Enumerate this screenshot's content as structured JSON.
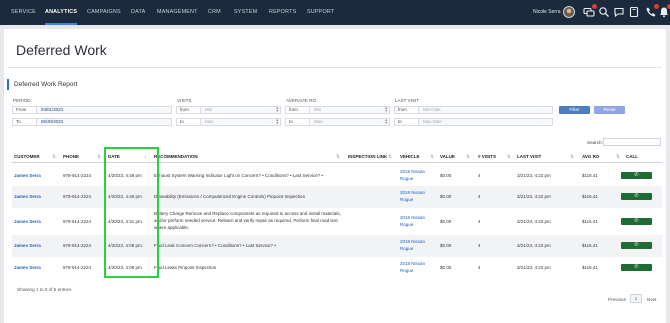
{
  "nav": {
    "items": [
      "SERVICE",
      "ANALYTICS",
      "CAMPAIGNS",
      "DATA",
      "MANAGEMENT",
      "CRM",
      "SYSTEM",
      "REPORTS",
      "SUPPORT"
    ],
    "active": "ANALYTICS",
    "user_name": "Nicole Serra"
  },
  "page": {
    "title": "Deferred Work",
    "section_title": "Deferred Work Report"
  },
  "filters": {
    "period_label": "PERIOD",
    "from_prefix": "From",
    "from_value": "04/01/2023",
    "to_prefix": "To",
    "to_value": "06/30/2023",
    "visits_label": "VISITS",
    "visits_from_prefix": "from",
    "visits_min_placeholder": "Min",
    "visits_to_prefix": "to",
    "visits_max_placeholder": "Max",
    "avgro_label": "AVERAGE RO",
    "avgro_from_prefix": "from",
    "avgro_min_placeholder": "Min",
    "avgro_to_prefix": "to",
    "avgro_max_placeholder": "Max",
    "lastvisit_label": "LAST VISIT",
    "lastvisit_from_prefix": "from",
    "lastvisit_min_placeholder": "Min Date",
    "lastvisit_to_prefix": "to",
    "lastvisit_max_placeholder": "Max Date",
    "filter_button": "Filter",
    "reset_button": "Reset"
  },
  "search": {
    "label": "Search:",
    "value": ""
  },
  "table": {
    "columns": [
      "CUSTOMER",
      "PHONE",
      "DATE",
      "RECOMMENDATION",
      "INSPECTION LINK",
      "VEHICLE",
      "VALUE",
      "# VISITS",
      "LAST VISIT",
      "AVG RO",
      "CALL"
    ],
    "rows": [
      {
        "customer": "James Serra",
        "phone": "978-914-2224",
        "date": "4/20/23, 4:46 pm",
        "recommendation": "Exhaust System Warning Indicator Light on Concern? • Conditions? • Last Service? •",
        "vehicle_line1": "2018 Nissan",
        "vehicle_line2": "Rogue",
        "value": "$0.00",
        "visits": "4",
        "last_visit": "3/21/23, 4:22 pm",
        "avg_ro": "$116.41",
        "call_icon": "phone-icon"
      },
      {
        "customer": "James Serra",
        "phone": "978-914-2224",
        "date": "4/20/23, 4:46 pm",
        "recommendation": "Driveability (Emissions / Computerized Engine Controls) Pinpoint Inspection",
        "vehicle_line1": "2018 Nissan",
        "vehicle_line2": "Rogue",
        "value": "$0.00",
        "visits": "4",
        "last_visit": "3/21/23, 4:22 pm",
        "avg_ro": "$116.41",
        "call_icon": "phone-icon"
      },
      {
        "customer": "James Serra",
        "phone": "978-914-2224",
        "date": "4/20/23, 4:31 pm",
        "recommendation": "Battery Charge Remove and Replace components as required to access and install materials, and/or perform needed service. Relearn and verify repair as required. Perform final road test where applicable.",
        "vehicle_line1": "2018 Nissan",
        "vehicle_line2": "Rogue",
        "value": "$0.00",
        "visits": "4",
        "last_visit": "3/21/23, 4:22 pm",
        "avg_ro": "$116.41",
        "call_icon": "phone-icon"
      },
      {
        "customer": "James Serra",
        "phone": "978-914-2224",
        "date": "4/20/23, 4:08 pm",
        "recommendation": "Fluid Leak Concern Concern? • Conditions? • Last Service? •",
        "vehicle_line1": "2018 Nissan",
        "vehicle_line2": "Rogue",
        "value": "$0.00",
        "visits": "4",
        "last_visit": "3/21/23, 4:22 pm",
        "avg_ro": "$116.41",
        "call_icon": "phone-icon"
      },
      {
        "customer": "James Serra",
        "phone": "978-914-2224",
        "date": "4/20/23, 4:08 pm",
        "recommendation": "Fluid Leaks Pinpoint Inspection",
        "vehicle_line1": "2018 Nissan",
        "vehicle_line2": "Rogue",
        "value": "$0.00",
        "visits": "4",
        "last_visit": "3/21/23, 4:22 pm",
        "avg_ro": "$116.41",
        "call_icon": "phone-icon"
      }
    ]
  },
  "footer": {
    "showing": "Showing 1 to 5 of 5 entries",
    "previous": "Previous",
    "page": "1",
    "next": "Next"
  },
  "colors": {
    "nav_bg": "#1c2a3d",
    "accent": "#2f6fd6",
    "call_button": "#1e6b33",
    "highlight": "#27d13f",
    "filter_button": "#4d7ebd",
    "reset_button": "#8fa6e0"
  }
}
